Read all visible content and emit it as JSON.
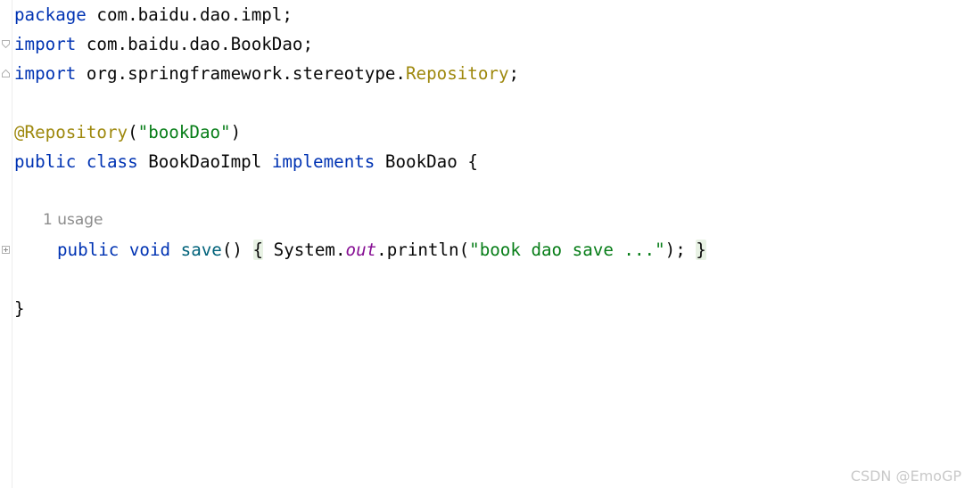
{
  "code": {
    "line1": {
      "kw": "package",
      "rest": " com.baidu.dao.impl;"
    },
    "line2": {
      "kw": "import",
      "rest": " com.baidu.dao.BookDao;"
    },
    "line3": {
      "kw": "import",
      "pkg": " org.springframework.stereotype.",
      "cls": "Repository",
      "end": ";"
    },
    "line5": {
      "ann": "@Repository",
      "open": "(",
      "str": "\"bookDao\"",
      "close": ")"
    },
    "line6": {
      "kw1": "public",
      "kw2": "class",
      "name": " BookDaoImpl ",
      "kw3": "implements",
      "iface": " BookDao {"
    },
    "usage_hint": "1 usage",
    "line8": {
      "kw1": "public",
      "kw2": "void",
      "method": "save",
      "parens": "() ",
      "brace_open": "{",
      "sys": " System.",
      "field": "out",
      "call": ".println(",
      "str": "\"book dao save ...\"",
      "end": "); ",
      "brace_close": "}"
    },
    "line10": "}"
  },
  "watermark": "CSDN @EmoGP"
}
